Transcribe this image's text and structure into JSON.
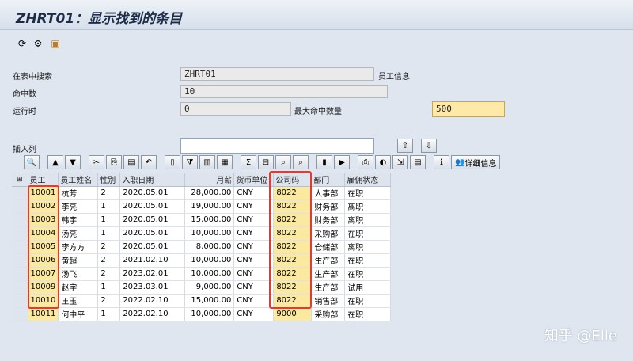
{
  "window": {
    "title": "ZHRT01：显示找到的条目"
  },
  "app_toolbar": [
    {
      "icon": "refresh-icon",
      "glyph": "⟳"
    },
    {
      "icon": "settings-icon",
      "glyph": "⚙"
    },
    {
      "icon": "save-icon",
      "glyph": "▣"
    }
  ],
  "form": {
    "table_label": "在表中搜索",
    "table_value": "ZHRT01",
    "table_desc": "员工信息",
    "hits_label": "命中数",
    "hits_value": "10",
    "runtime_label": "运行时",
    "runtime_value": "0",
    "max_hits_label": "最大命中数量",
    "max_hits_value": "500",
    "insert_col_label": "插入列",
    "insert_col_value": ""
  },
  "grid_toolbar": {
    "detail_label": "详细信息"
  },
  "table": {
    "columns": [
      "员工",
      "员工姓名",
      "性别",
      "入职日期",
      "月薪",
      "货币单位",
      "公司码",
      "部门",
      "雇佣状态"
    ],
    "rows": [
      [
        "10001",
        "杭芳",
        "2",
        "2020.05.01",
        "28,000.00",
        "CNY",
        "8022",
        "人事部",
        "在职"
      ],
      [
        "10002",
        "李亮",
        "1",
        "2020.05.01",
        "19,000.00",
        "CNY",
        "8022",
        "财务部",
        "离职"
      ],
      [
        "10003",
        "韩宇",
        "1",
        "2020.05.01",
        "15,000.00",
        "CNY",
        "8022",
        "财务部",
        "离职"
      ],
      [
        "10004",
        "汤亮",
        "1",
        "2020.05.01",
        "10,000.00",
        "CNY",
        "8022",
        "采购部",
        "在职"
      ],
      [
        "10005",
        "李方方",
        "2",
        "2020.05.01",
        "8,000.00",
        "CNY",
        "8022",
        "仓储部",
        "离职"
      ],
      [
        "10006",
        "黄超",
        "2",
        "2021.02.10",
        "10,000.00",
        "CNY",
        "8022",
        "生产部",
        "在职"
      ],
      [
        "10007",
        "汤飞",
        "2",
        "2023.02.01",
        "10,000.00",
        "CNY",
        "8022",
        "生产部",
        "在职"
      ],
      [
        "10009",
        "赵宇",
        "1",
        "2023.03.01",
        "9,000.00",
        "CNY",
        "8022",
        "生产部",
        "试用"
      ],
      [
        "10010",
        "王玉",
        "2",
        "2022.02.10",
        "15,000.00",
        "CNY",
        "8022",
        "销售部",
        "在职"
      ],
      [
        "10011",
        "何中平",
        "1",
        "2022.02.10",
        "10,000.00",
        "CNY",
        "9000",
        "采购部",
        "在职"
      ]
    ]
  },
  "watermark": "知乎 @Elle",
  "colors": {
    "highlight": "#e03c34",
    "key_cell": "#fbe9a0",
    "title": "#1d2d49"
  }
}
